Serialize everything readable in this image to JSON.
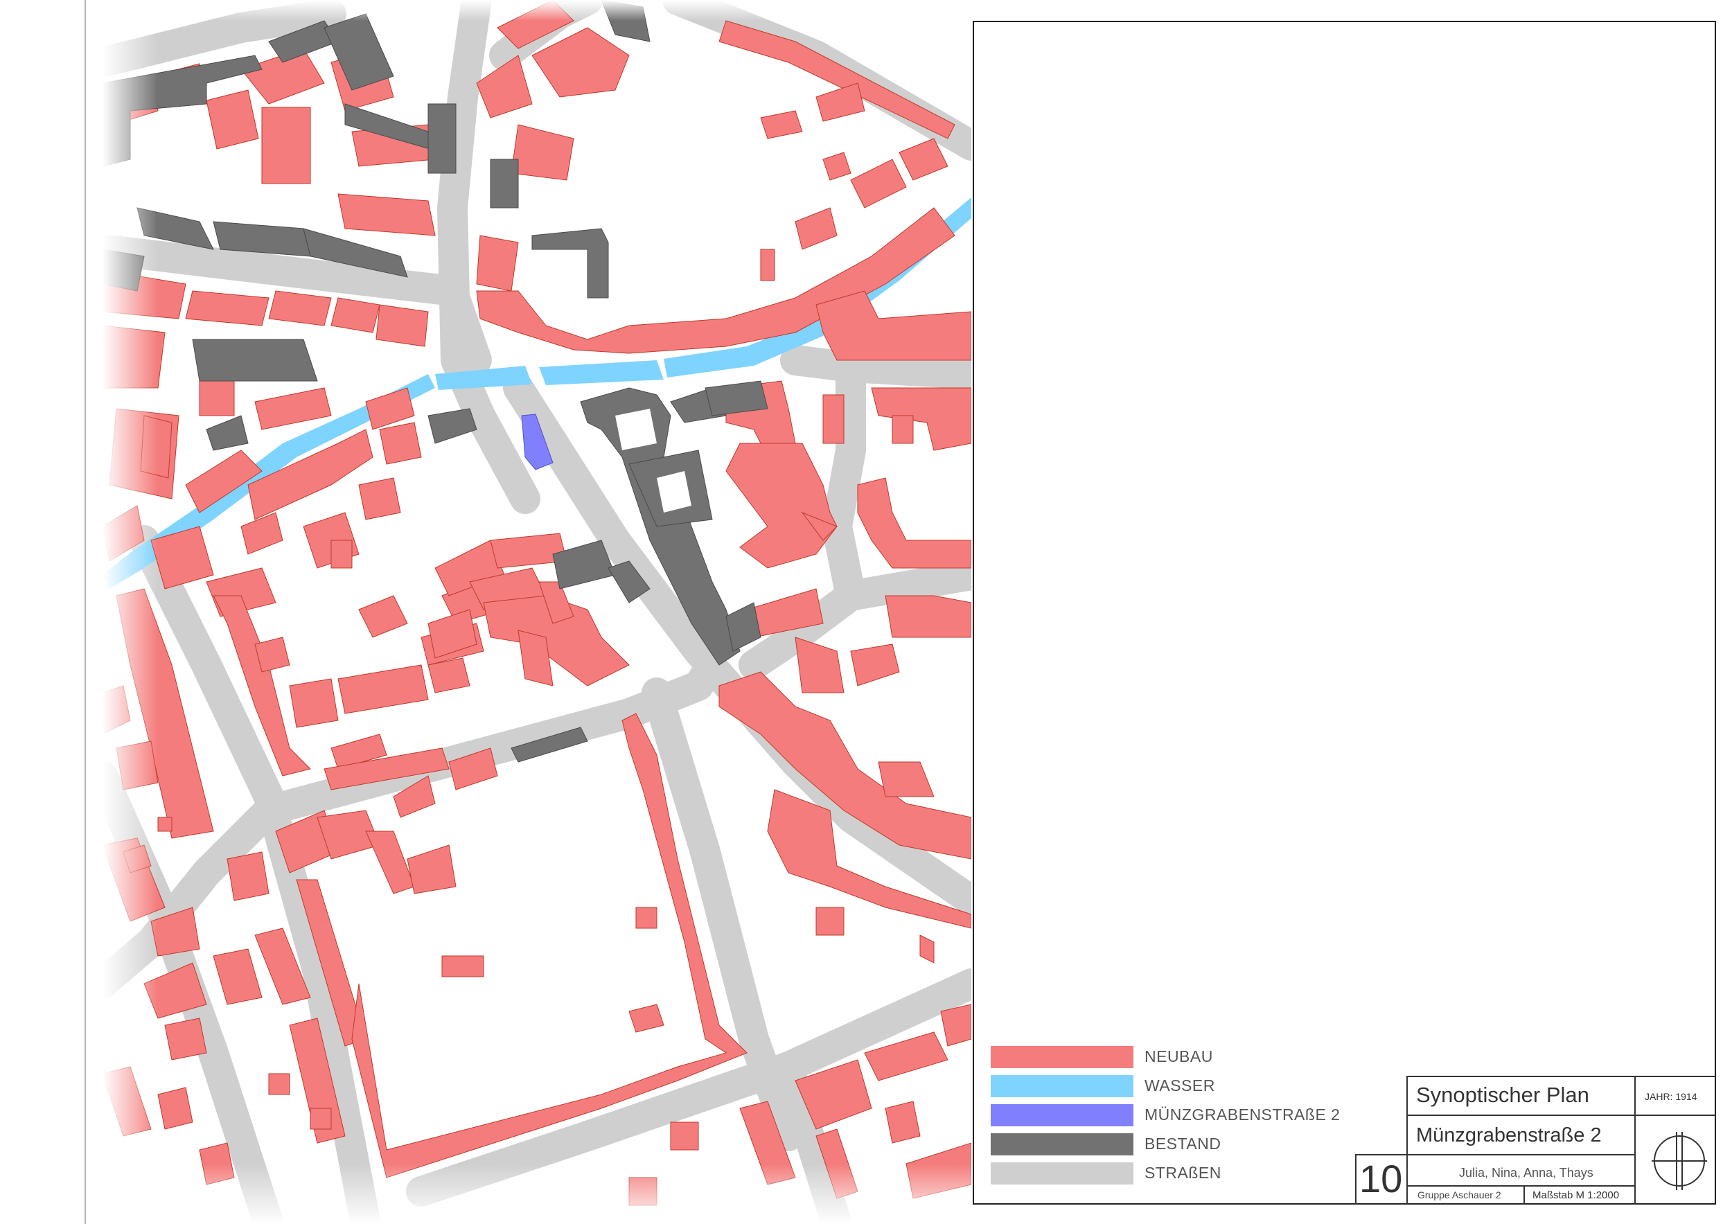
{
  "legend": {
    "items": [
      {
        "label": "NEUBAU",
        "color": "#f47c7c"
      },
      {
        "label": "WASSER",
        "color": "#7fd3ff"
      },
      {
        "label": "MÜNZGRABENSTRAßE 2",
        "color": "#8080ff"
      },
      {
        "label": "BESTAND",
        "color": "#727272"
      },
      {
        "label": "STRAßEN",
        "color": "#cfcfcf"
      }
    ]
  },
  "title_block": {
    "title": "Synoptischer Plan",
    "year": "JAHR: 1914",
    "subject": "Münzgrabenstraße 2",
    "sheet_number": "10",
    "authors": "Julia, Nina, Anna, Thays",
    "group": "Gruppe Aschauer 2",
    "scale": "Maßstab M 1:2000"
  },
  "map": {
    "colors": {
      "neubau": "#f47c7c",
      "wasser": "#7fd3ff",
      "highlight": "#8080ff",
      "bestand": "#727272",
      "strassen": "#cfcfcf",
      "outline": "#c0392b"
    }
  }
}
